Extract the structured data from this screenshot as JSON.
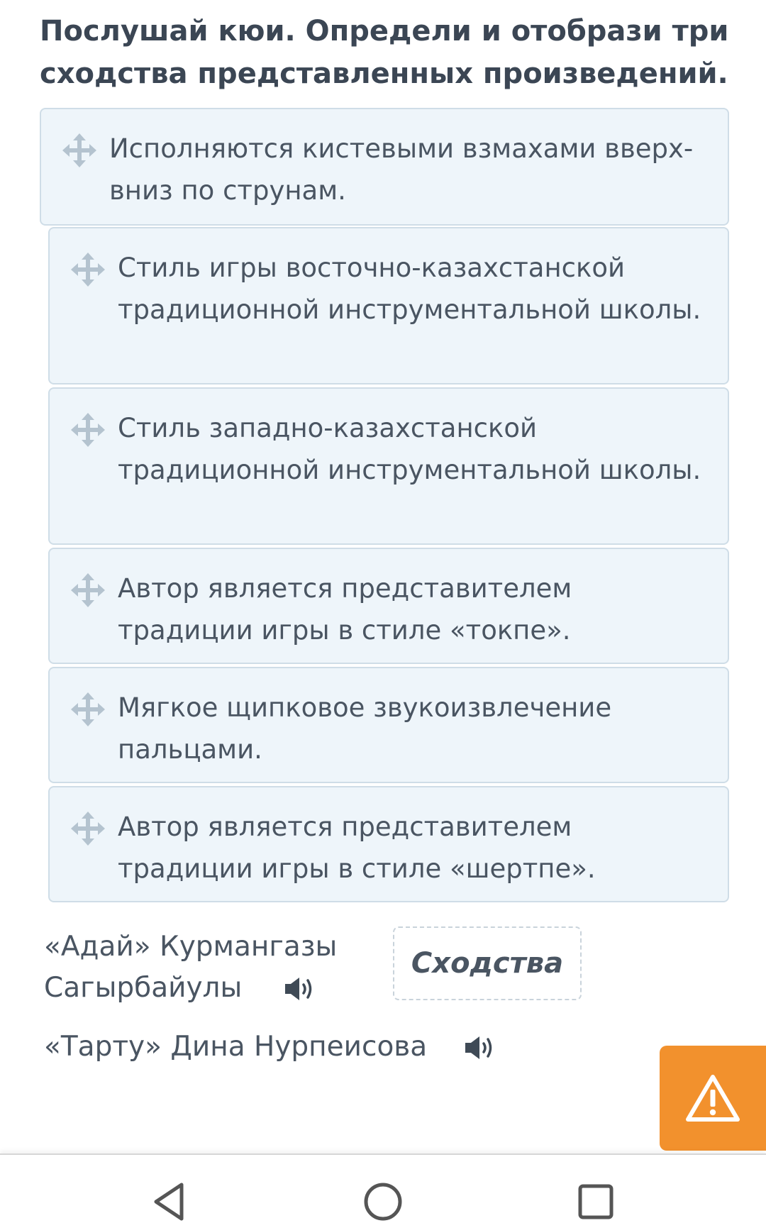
{
  "header": {
    "title": "Послушай кюи. Определи и отобрази три сходства представленных произведений."
  },
  "cards": [
    {
      "text": "Исполняются кистевыми взмахами вверх-вниз по струнам."
    },
    {
      "text": "Стиль игры восточно-казахстанской традиционной инструментальной школы."
    },
    {
      "text": "Стиль западно-казахстанской традиционной инструментальной школы."
    },
    {
      "text": "Автор является представителем традиции игры в стиле «токпе»."
    },
    {
      "text": "Мягкое щипковое звукоизвлечение пальцами."
    },
    {
      "text": "Автор является представителем традиции игры в стиле «шертпе»."
    }
  ],
  "pieces": [
    {
      "line1": "«Адай» Курмангазы",
      "line2": "Сагырбайулы"
    },
    {
      "line1": "«Тарту» Дина Нурпеисова"
    }
  ],
  "dropzone": {
    "label": "Сходства"
  },
  "icons": {
    "drag": "move-arrows-icon",
    "sound": "speaker-icon",
    "warning": "warning-triangle-icon",
    "nav_back": "back-triangle-icon",
    "nav_home": "home-circle-icon",
    "nav_recent": "recent-square-icon"
  },
  "colors": {
    "card_background": "#eef5fa",
    "card_border": "#cfdde7",
    "text": "#4a5562",
    "warning_button": "#f2912d"
  }
}
